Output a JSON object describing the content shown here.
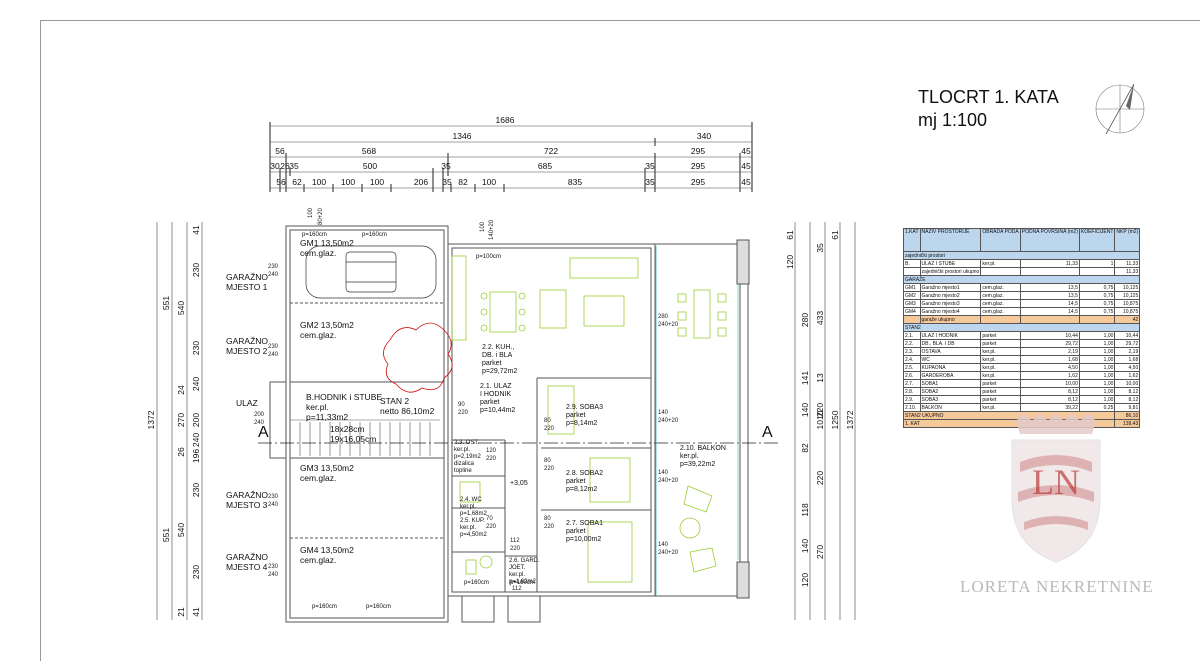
{
  "title": {
    "line1": "TLOCRT 1. KATA",
    "line2": "mj 1:100"
  },
  "dims_top": {
    "row1": [
      "1686"
    ],
    "row2": [
      "1346",
      "340"
    ],
    "row3": [
      "56",
      "568",
      "722",
      "295",
      "45"
    ],
    "row4": [
      "30",
      "26",
      "35",
      "500",
      "35",
      "685",
      "35",
      "295",
      "45"
    ],
    "row5": [
      "56",
      "62",
      "100",
      "100",
      "100",
      "206",
      "35",
      "82",
      "100",
      "835",
      "35",
      "295",
      "45"
    ]
  },
  "dims_left": [
    "1372",
    "551",
    "540",
    "24",
    "270",
    "26",
    "540",
    "551",
    "21",
    "41",
    "230",
    "230",
    "240",
    "200",
    "240",
    "196",
    "230",
    "230",
    "41"
  ],
  "dims_right": [
    "1372",
    "1010",
    "1250",
    "280",
    "433",
    "141",
    "220",
    "220",
    "270",
    "61",
    "120",
    "61",
    "35",
    "140",
    "13",
    "82",
    "118",
    "140",
    "120"
  ],
  "axis_marks": {
    "left": "A",
    "right": "A"
  },
  "rooms": {
    "gm1": {
      "title": "GM1 13,50m2",
      "floor": "cem.glaz."
    },
    "gm2": {
      "title": "GM2 13,50m2",
      "floor": "cem.glaz."
    },
    "gm3": {
      "title": "GM3 13,50m2",
      "floor": "cem.glaz."
    },
    "gm4": {
      "title": "GM4 13,50m2",
      "floor": "cem.glaz."
    },
    "gp1": {
      "l1": "GARAŽNO",
      "l2": "MJESTO 1"
    },
    "gp2": {
      "l1": "GARAŽNO",
      "l2": "MJESTO 2"
    },
    "gp3": {
      "l1": "GARAŽNO",
      "l2": "MJESTO 3"
    },
    "gp4": {
      "l1": "GARAŽNO",
      "l2": "MJESTO 4"
    },
    "ulaz": "ULAZ",
    "hodnik": {
      "l1": "B.HODNIK i STUBE",
      "l2": "ker.pl.",
      "l3": "p=11,33m2"
    },
    "stairs": {
      "l1": "18x28cm",
      "l2": "19x16,05cm"
    },
    "stan2": {
      "l1": "STAN 2",
      "l2": "netto 86,10m2"
    },
    "kuh": {
      "l1": "2.2. KUH.,",
      "l2": "DB. i BLA",
      "l3": "parket",
      "l4": "p=29,72m2"
    },
    "ulaz21": {
      "l1": "2.1. ULAZ",
      "l2": "I HODNIK",
      "l3": "parket",
      "l4": "p=10,44m2"
    },
    "soba3": {
      "l1": "2.9. SOBA3",
      "l2": "parket",
      "l3": "p=8,14m2"
    },
    "soba2": {
      "l1": "2.8. SOBA2",
      "l2": "parket",
      "l3": "p=8,12m2"
    },
    "soba1": {
      "l1": "2.7. SOBA1",
      "l2": "parket",
      "l3": "p=10,00m2"
    },
    "balkon": {
      "l1": "2.10. BALKON",
      "l2": "ker.pl.",
      "l3": "p=39,22m2"
    },
    "ostava": {
      "l1": "2.3. OST.",
      "l2": "ker.pl.",
      "l3": "p=2,19m2",
      "l4": "dizalica",
      "l5": "topline"
    },
    "wc": {
      "l1": "2.4. WC",
      "l2": "ker.pl.",
      "l3": "p=1,68m2"
    },
    "kup": {
      "l1": "2.5. KUP.",
      "l2": "ker.pl.",
      "l3": "p=4,50m2"
    },
    "gard": {
      "l1": "2.6. GARD.",
      "l2": "JOET.",
      "l3": "ker.pl.",
      "l4": "p=1,62m2"
    },
    "level": "+3,05",
    "p160": "p=160cm",
    "p100": "p=100cm"
  },
  "table": {
    "header_title": "1.KAT",
    "columns": [
      "NAZIV PROSTORIJE",
      "OBRADA PODA",
      "PODNA POVRŠINA (m2)",
      "KOEFICIJENT",
      "NKP (m2)"
    ],
    "sections": [
      {
        "name": "zajednički prostori",
        "rows": [
          [
            "B.",
            "ULAZ I STUBE",
            "ker.pl.",
            "11,33",
            "1",
            "11,33"
          ],
          [
            "",
            "zajednički prostori ukupno",
            "",
            "",
            "",
            "11,33"
          ]
        ]
      },
      {
        "name": "GARAŽE",
        "rows": [
          [
            "GM1",
            "Garažno mjesto1",
            "cem.glaz.",
            "13,5",
            "0,75",
            "10,125"
          ],
          [
            "GM2",
            "Garažno mjesto2",
            "cem.glaz.",
            "13,5",
            "0,75",
            "10,125"
          ],
          [
            "GM3",
            "Garažno mjesto3",
            "cem.glaz.",
            "14,5",
            "0,75",
            "10,875"
          ],
          [
            "GM4",
            "Garažno mjesto4",
            "cem.glaz.",
            "14,5",
            "0,75",
            "10,875"
          ]
        ],
        "summary": [
          "",
          "garaže ukupno",
          "",
          "",
          "",
          "42"
        ]
      },
      {
        "name": "STAN2",
        "rows": [
          [
            "2.1.",
            "ULAZ I HODNIK",
            "parket",
            "10,44",
            "1,00",
            "10,44"
          ],
          [
            "2.2.",
            "DB., BLA. I DB",
            "parket",
            "29,72",
            "1,00",
            "29,72"
          ],
          [
            "2.3.",
            "OSTAVA",
            "ker.pl.",
            "2,19",
            "1,00",
            "2,19"
          ],
          [
            "2.4.",
            "WC",
            "ker.pl.",
            "1,68",
            "1,00",
            "1,68"
          ],
          [
            "2.5.",
            "KUPAONA",
            "ker.pl.",
            "4,50",
            "1,00",
            "4,50"
          ],
          [
            "2.6.",
            "GARDEROBA",
            "ker.pl.",
            "1,62",
            "1,00",
            "1,62"
          ],
          [
            "2.7.",
            "SOBA1",
            "parket",
            "10,00",
            "1,00",
            "10,00"
          ],
          [
            "2.8.",
            "SOBA2",
            "parket",
            "8,12",
            "1,00",
            "8,12"
          ],
          [
            "2.9.",
            "SOBA3",
            "parket",
            "8,12",
            "1,00",
            "8,12"
          ],
          [
            "2.10.",
            "BALKON",
            "ker.pl.",
            "39,22",
            "0,25",
            "9,81"
          ]
        ]
      },
      {
        "name": "STAN2 UKUPNO",
        "rows": [],
        "summary": [
          "",
          "",
          "",
          "",
          "",
          "86,10"
        ]
      },
      {
        "name": "1. KAT",
        "rows": [],
        "summary": [
          "",
          "",
          "",
          "",
          "",
          "139,43"
        ]
      }
    ]
  },
  "watermark": {
    "monogram": "LN",
    "brand": "LORETA NEKRETNINE"
  },
  "colors": {
    "furniture": "#9acd32",
    "wall": "#555555",
    "revision": "#cc1111",
    "table_section": "#bcd6ee",
    "table_summary": "#f6c99a",
    "logo": "#b31b1b"
  }
}
